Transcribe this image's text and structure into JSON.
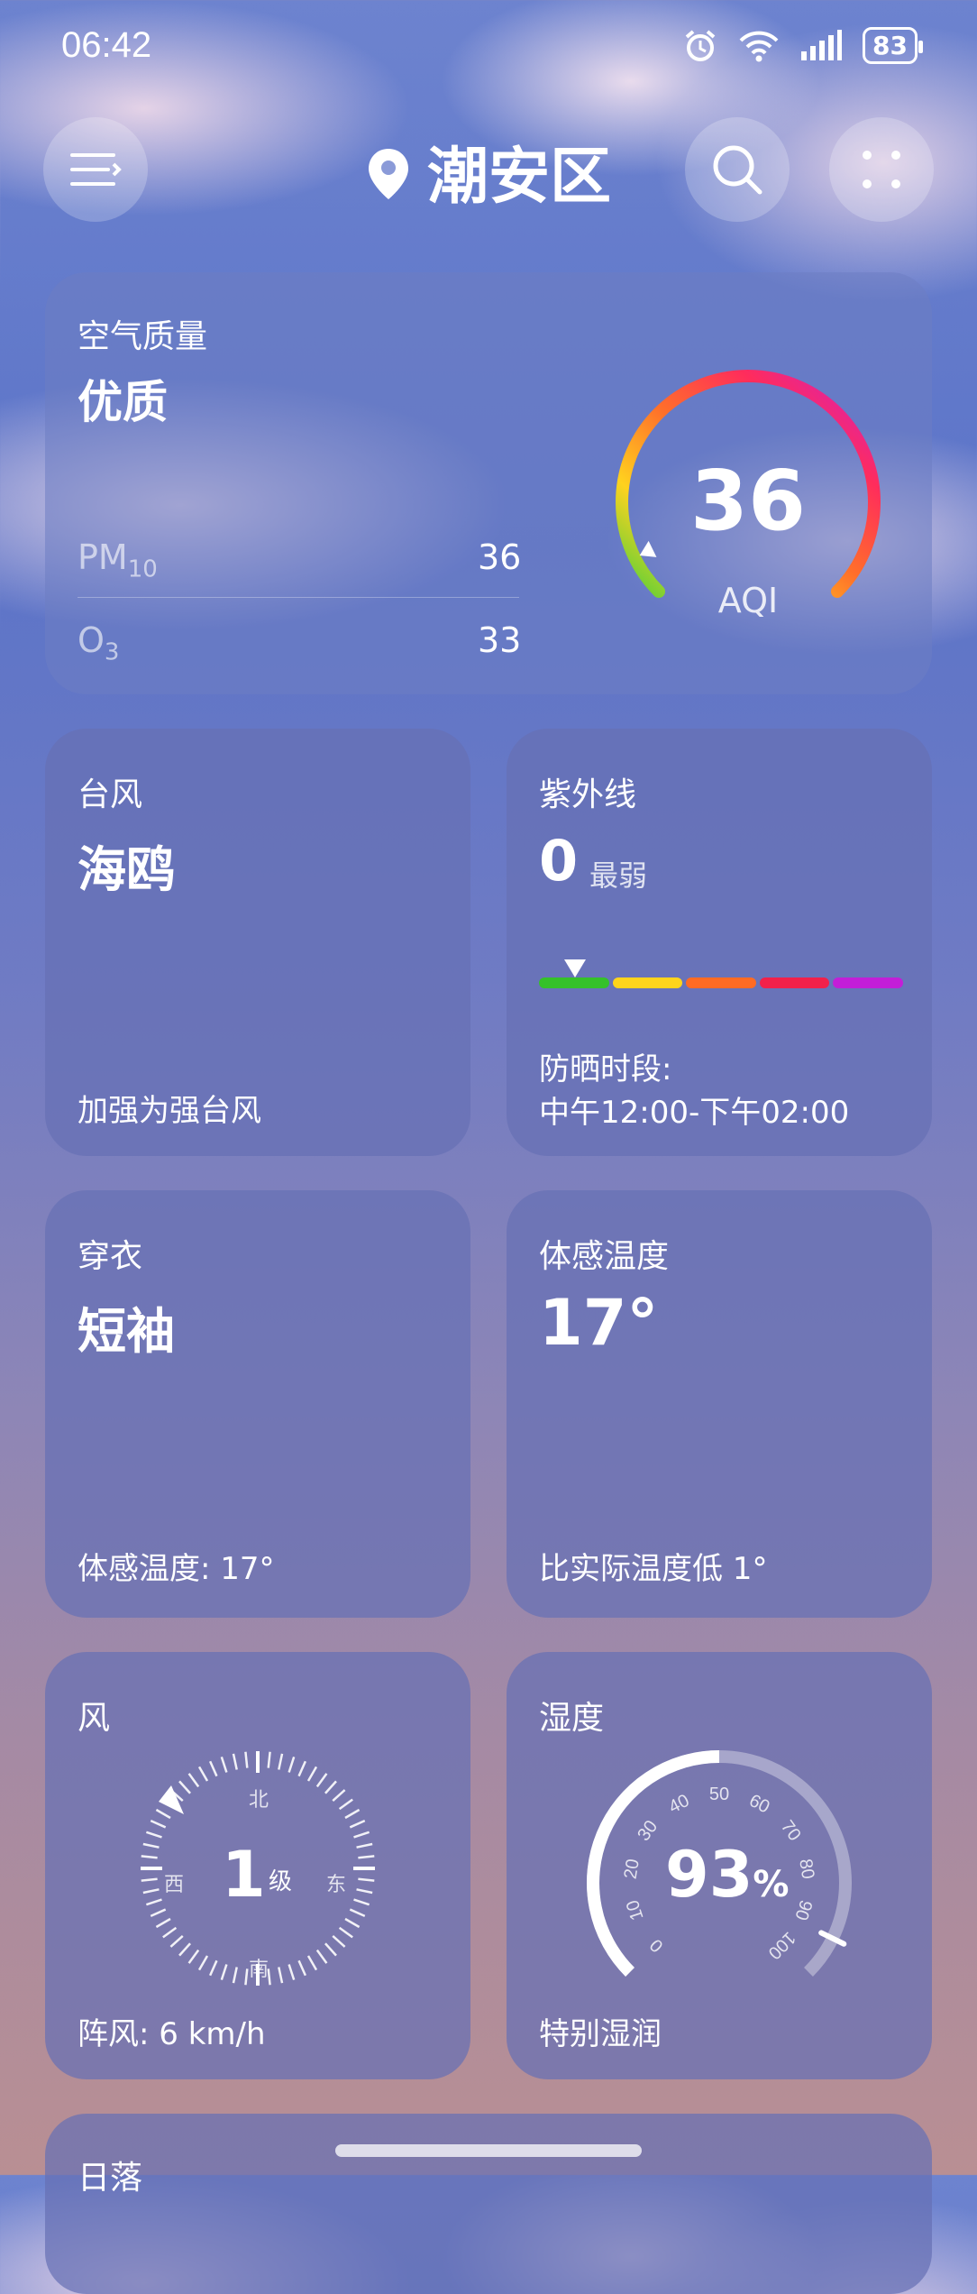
{
  "status_bar": {
    "time": "06:42",
    "battery": "83"
  },
  "header": {
    "location": "潮安区"
  },
  "air": {
    "title": "空气质量",
    "quality": "优质",
    "pm_label": "PM",
    "pm_sub": "10",
    "pm_value": "36",
    "o3_label": "O",
    "o3_sub": "3",
    "o3_value": "33",
    "aqi_value": "36",
    "aqi_label": "AQI",
    "aqi_fraction": 0.07
  },
  "typhoon": {
    "title": "台风",
    "name": "海鸥",
    "desc": "加强为强台风"
  },
  "uv": {
    "title": "紫外线",
    "value": "0",
    "level": "最弱",
    "protect_label": "防晒时段:",
    "protect_time": "中午12:00-下午02:00",
    "colors": [
      "#35c12a",
      "#ffd41c",
      "#ff6b24",
      "#f2214a",
      "#c31ed8"
    ]
  },
  "clothing": {
    "title": "穿衣",
    "value": "短袖",
    "desc": "体感温度: 17°"
  },
  "feels": {
    "title": "体感温度",
    "value": "17°",
    "desc": "比实际温度低 1°"
  },
  "wind": {
    "title": "风",
    "level": "1",
    "unit": "级",
    "north": "北",
    "south": "南",
    "east": "东",
    "west": "西",
    "gust": "阵风: 6 km/h"
  },
  "humidity": {
    "title": "湿度",
    "value": "93",
    "unit": "%",
    "desc": "特别湿润",
    "ticks": [
      "0",
      "10",
      "20",
      "30",
      "40",
      "50",
      "60",
      "70",
      "80",
      "90",
      "100"
    ]
  },
  "next_card": {
    "title": "日落"
  }
}
